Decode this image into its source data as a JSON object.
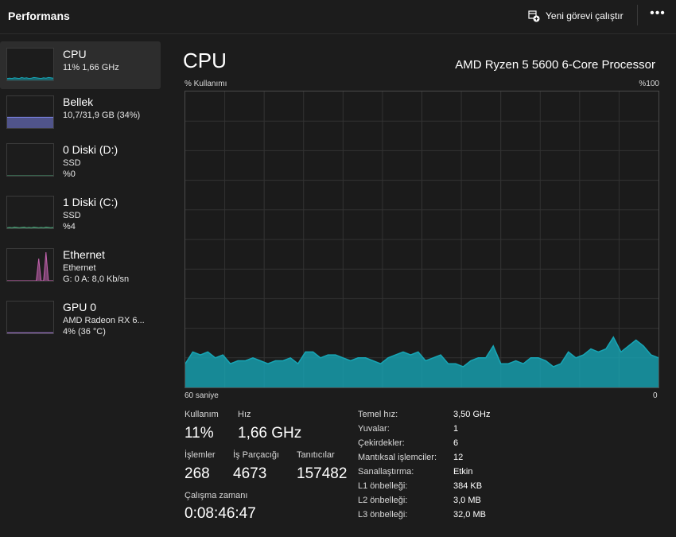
{
  "header": {
    "title": "Performans",
    "new_task_label": "Yeni görevi çalıştır",
    "new_task_icon": "run-task-icon",
    "more_icon": "more-icon"
  },
  "sidebar": {
    "items": [
      {
        "name": "CPU",
        "line1": "11%  1,66 GHz",
        "line2": "",
        "color": "#17a5b5",
        "graph": [
          6,
          7,
          6,
          8,
          7,
          6,
          9,
          7,
          8,
          6,
          7,
          9,
          8,
          7,
          6,
          8,
          7,
          9,
          8,
          7
        ]
      },
      {
        "name": "Bellek",
        "line1": "10,7/31,9 GB (34%)",
        "line2": "",
        "color": "#7b84e6",
        "graph": [
          34,
          34,
          34,
          34,
          34,
          34,
          34,
          34,
          34,
          34,
          34,
          34,
          34,
          34,
          34,
          34,
          34,
          34,
          34,
          34
        ]
      },
      {
        "name": "0 Diski (D:)",
        "line1": "SSD",
        "line2": "%0",
        "color": "#4fa37a",
        "graph": [
          0,
          0,
          0,
          0,
          0,
          0,
          0,
          0,
          0,
          0,
          0,
          0,
          0,
          0,
          0,
          0,
          0,
          0,
          0,
          0
        ]
      },
      {
        "name": "1 Diski (C:)",
        "line1": "SSD",
        "line2": "%4",
        "color": "#4fa37a",
        "graph": [
          2,
          3,
          2,
          4,
          3,
          2,
          3,
          4,
          2,
          3,
          2,
          4,
          3,
          2,
          3,
          2,
          4,
          3,
          2,
          3
        ]
      },
      {
        "name": "Ethernet",
        "line1": "Ethernet",
        "line2": "G: 0 A: 8,0 Kb/sn",
        "color": "#c563b0",
        "graph": [
          0,
          0,
          0,
          0,
          0,
          0,
          0,
          0,
          0,
          0,
          0,
          0,
          0,
          70,
          0,
          0,
          90,
          0,
          0,
          0
        ]
      },
      {
        "name": "GPU 0",
        "line1": "AMD Radeon RX 6...",
        "line2": "4%  (36 °C)",
        "color": "#a67bd1",
        "graph": [
          2,
          2,
          2,
          2,
          2,
          2,
          2,
          2,
          2,
          2,
          2,
          2,
          2,
          2,
          2,
          2,
          2,
          2,
          2,
          2
        ]
      }
    ]
  },
  "main": {
    "title": "CPU",
    "processor": "AMD Ryzen 5 5600 6-Core Processor",
    "y_label": "% Kullanımı",
    "y_max_label": "%100",
    "x_left_label": "60 saniye",
    "x_right_label": "0",
    "graph_color": "#17a5b5",
    "usage_series": [
      8,
      12,
      11,
      12,
      10,
      11,
      8,
      9,
      9,
      10,
      9,
      8,
      9,
      9,
      10,
      8,
      12,
      12,
      10,
      11,
      11,
      10,
      9,
      10,
      10,
      9,
      8,
      10,
      11,
      12,
      11,
      12,
      9,
      10,
      11,
      8,
      8,
      7,
      9,
      10,
      10,
      14,
      8,
      8,
      9,
      8,
      10,
      10,
      9,
      7,
      8,
      12,
      10,
      11,
      13,
      12,
      13,
      17,
      12,
      14,
      16,
      14,
      11,
      10
    ]
  },
  "stats": {
    "usage_label": "Kullanım",
    "usage_value": "11%",
    "speed_label": "Hız",
    "speed_value": "1,66 GHz",
    "processes_label": "İşlemler",
    "processes_value": "268",
    "threads_label": "İş Parçacığı",
    "threads_value": "4673",
    "handles_label": "Tanıtıcılar",
    "handles_value": "157482",
    "uptime_label": "Çalışma zamanı",
    "uptime_value": "0:08:46:47"
  },
  "specs": [
    {
      "label": "Temel hız:",
      "value": "3,50 GHz"
    },
    {
      "label": "Yuvalar:",
      "value": "1"
    },
    {
      "label": "Çekirdekler:",
      "value": "6"
    },
    {
      "label": "Mantıksal işlemciler:",
      "value": "12"
    },
    {
      "label": "Sanallaştırma:",
      "value": "Etkin"
    },
    {
      "label": "L1 önbelleği:",
      "value": "384 KB"
    },
    {
      "label": "L2 önbelleği:",
      "value": "3,0 MB"
    },
    {
      "label": "L3 önbelleği:",
      "value": "32,0 MB"
    }
  ]
}
